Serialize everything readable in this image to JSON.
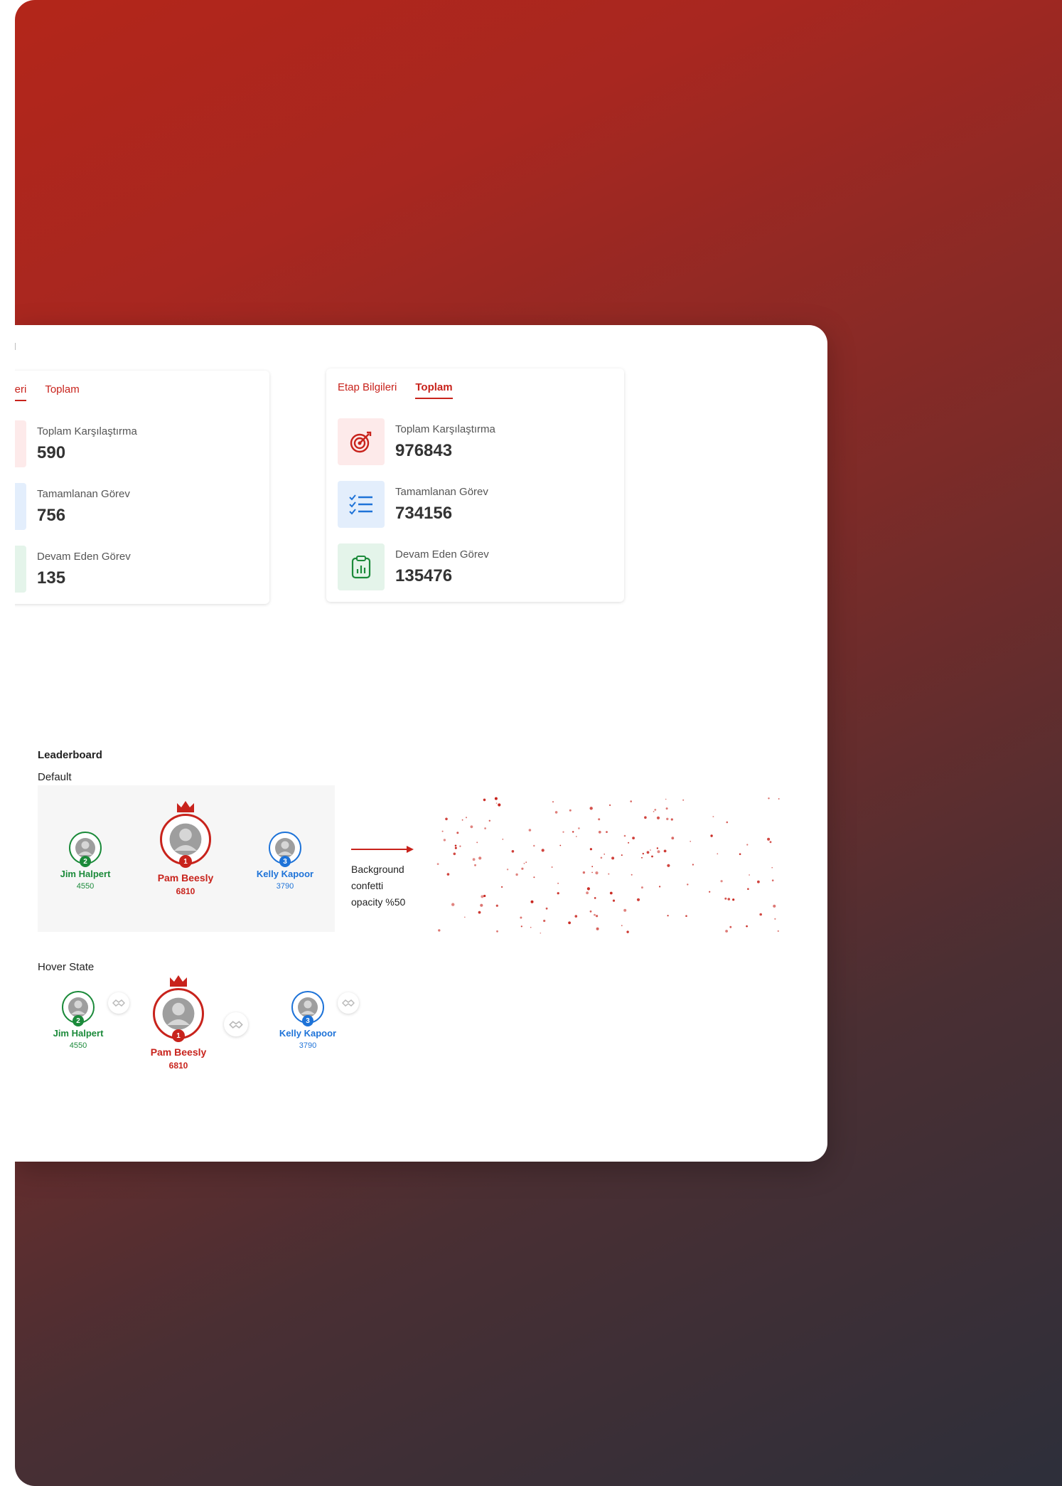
{
  "colors": {
    "accent": "#c8231c",
    "first": "#c8231c",
    "second": "#1b8a3a",
    "third": "#1e73d8"
  },
  "stats_left": {
    "tabs": [
      "ilgileri",
      "Toplam"
    ],
    "rows": [
      {
        "label": "Toplam Karşılaştırma",
        "value": "590",
        "icon": "target-icon"
      },
      {
        "label": "Tamamlanan Görev",
        "value": "756",
        "icon": "checklist-icon"
      },
      {
        "label": "Devam Eden Görev",
        "value": "135",
        "icon": "clipboard-chart-icon"
      }
    ]
  },
  "stats_right": {
    "tabs": [
      "Etap Bilgileri",
      "Toplam"
    ],
    "rows": [
      {
        "label": "Toplam Karşılaştırma",
        "value": "976843",
        "icon": "target-icon"
      },
      {
        "label": "Tamamlanan Görev",
        "value": "734156",
        "icon": "checklist-icon"
      },
      {
        "label": "Devam Eden Görev",
        "value": "135476",
        "icon": "clipboard-chart-icon"
      }
    ]
  },
  "leaderboard": {
    "title": "Leaderboard",
    "default_label": "Default",
    "hover_label": "Hover State",
    "players": [
      {
        "rank": "1",
        "name": "Pam Beesly",
        "score": "6810"
      },
      {
        "rank": "2",
        "name": "Jim Halpert",
        "score": "4550"
      },
      {
        "rank": "3",
        "name": "Kelly Kapoor",
        "score": "3790"
      }
    ],
    "note": {
      "line1": "Background",
      "line2": "confetti",
      "line3": "opacity %50"
    }
  }
}
